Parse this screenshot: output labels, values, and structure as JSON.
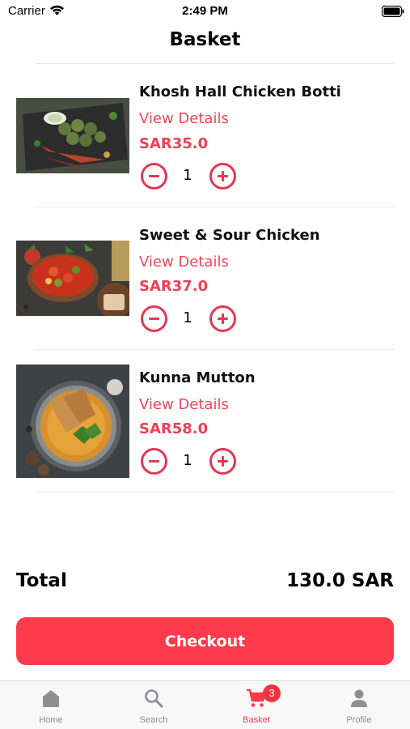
{
  "status_bar": {
    "carrier": "Carrier",
    "time": "2:49 PM"
  },
  "header": {
    "title": "Basket"
  },
  "items": [
    {
      "name": "Khosh Hall Chicken Botti",
      "details_label": "View Details",
      "price": "SAR35.0",
      "quantity": "1",
      "image_icon": "grilled-chicken-plate"
    },
    {
      "name": "Sweet & Sour Chicken",
      "details_label": "View Details",
      "price": "SAR37.0",
      "quantity": "1",
      "image_icon": "curry-pan"
    },
    {
      "name": "Kunna Mutton",
      "details_label": "View Details",
      "price": "SAR58.0",
      "quantity": "1",
      "image_icon": "mutton-bowl"
    }
  ],
  "total": {
    "label": "Total",
    "value": "130.0 SAR"
  },
  "checkout": {
    "label": "Checkout"
  },
  "tab_bar": {
    "tabs": [
      {
        "label": "Home",
        "icon": "home-icon"
      },
      {
        "label": "Search",
        "icon": "search-icon"
      },
      {
        "label": "Basket",
        "icon": "cart-icon",
        "badge": "3",
        "active": true
      },
      {
        "label": "Profile",
        "icon": "person-icon"
      }
    ]
  },
  "colors": {
    "accent": "#fd3b4c",
    "price": "#ef3f55",
    "link": "#f0475a",
    "badge": "#f0333f"
  }
}
